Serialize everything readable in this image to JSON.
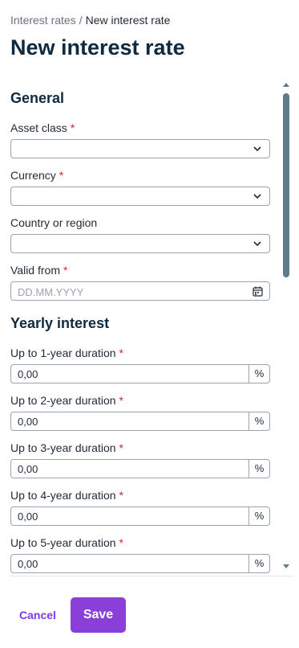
{
  "breadcrumb": {
    "parent": "Interest rates",
    "separator": "/",
    "current": "New interest rate"
  },
  "page_title": "New interest rate",
  "general": {
    "title": "General",
    "asset_class": {
      "label": "Asset class",
      "required": "*",
      "value": ""
    },
    "currency": {
      "label": "Currency",
      "required": "*",
      "value": ""
    },
    "country": {
      "label": "Country or region",
      "value": ""
    },
    "valid_from": {
      "label": "Valid from",
      "required": "*",
      "placeholder": "DD.MM.YYYY",
      "value": ""
    }
  },
  "yearly_interest": {
    "title": "Yearly interest",
    "fields": [
      {
        "label": "Up to 1-year duration",
        "required": "*",
        "value": "0,00",
        "unit": "%"
      },
      {
        "label": "Up to 2-year duration",
        "required": "*",
        "value": "0,00",
        "unit": "%"
      },
      {
        "label": "Up to 3-year duration",
        "required": "*",
        "value": "0,00",
        "unit": "%"
      },
      {
        "label": "Up to 4-year duration",
        "required": "*",
        "value": "0,00",
        "unit": "%"
      },
      {
        "label": "Up to 5-year duration",
        "required": "*",
        "value": "0,00",
        "unit": "%"
      }
    ]
  },
  "footer": {
    "cancel_label": "Cancel",
    "save_label": "Save"
  },
  "colors": {
    "accent": "#8b3fd9",
    "required": "#dc2626",
    "title": "#0f2a3f",
    "scrollbar": "#5f7c8c"
  },
  "icons": {
    "dropdown": "chevron-down-icon",
    "date": "calendar-icon",
    "scroll_up": "scroll-up-arrow-icon",
    "scroll_down": "scroll-down-arrow-icon"
  }
}
